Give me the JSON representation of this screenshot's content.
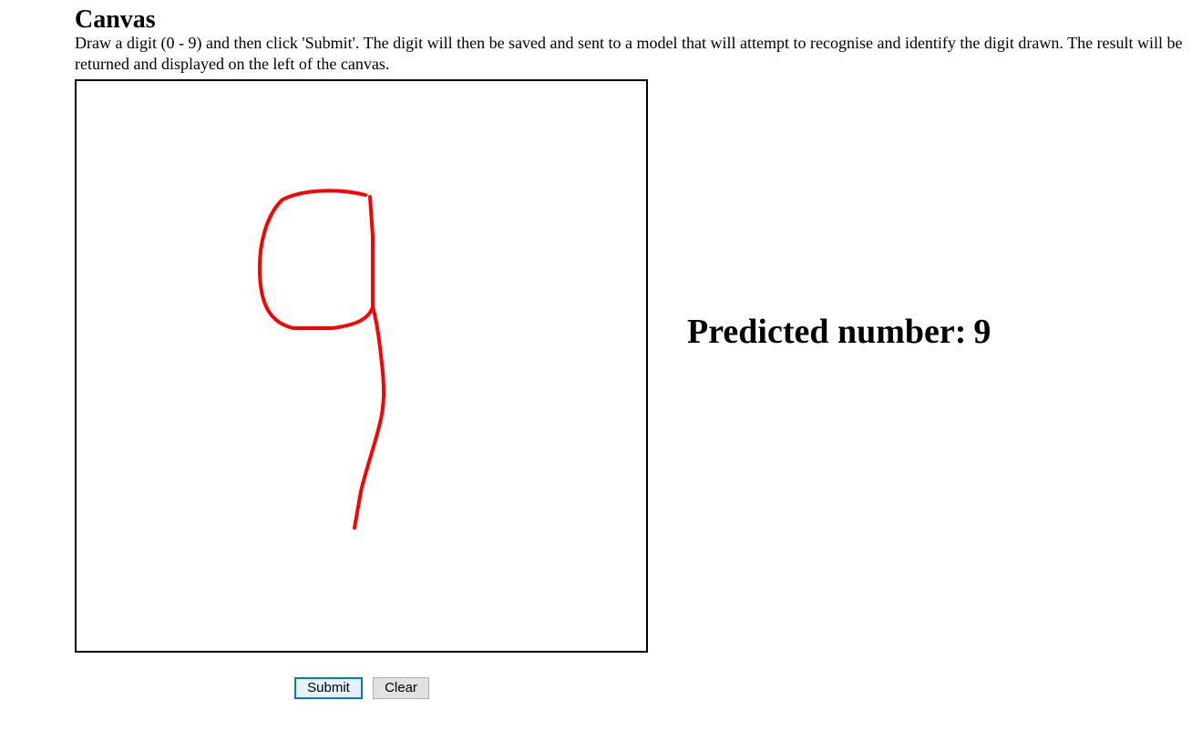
{
  "page": {
    "title": "Canvas",
    "description": "Draw a digit (0 - 9) and then click 'Submit'. The digit will then be saved and sent to a model that will attempt to recognise and identify the digit drawn. The result will be returned and displayed on the left of the canvas."
  },
  "canvas": {
    "stroke_color": "#ff0000",
    "border_color": "#000000"
  },
  "result": {
    "label": "Predicted number:",
    "value": "9"
  },
  "buttons": {
    "submit_label": "Submit",
    "clear_label": "Clear"
  }
}
